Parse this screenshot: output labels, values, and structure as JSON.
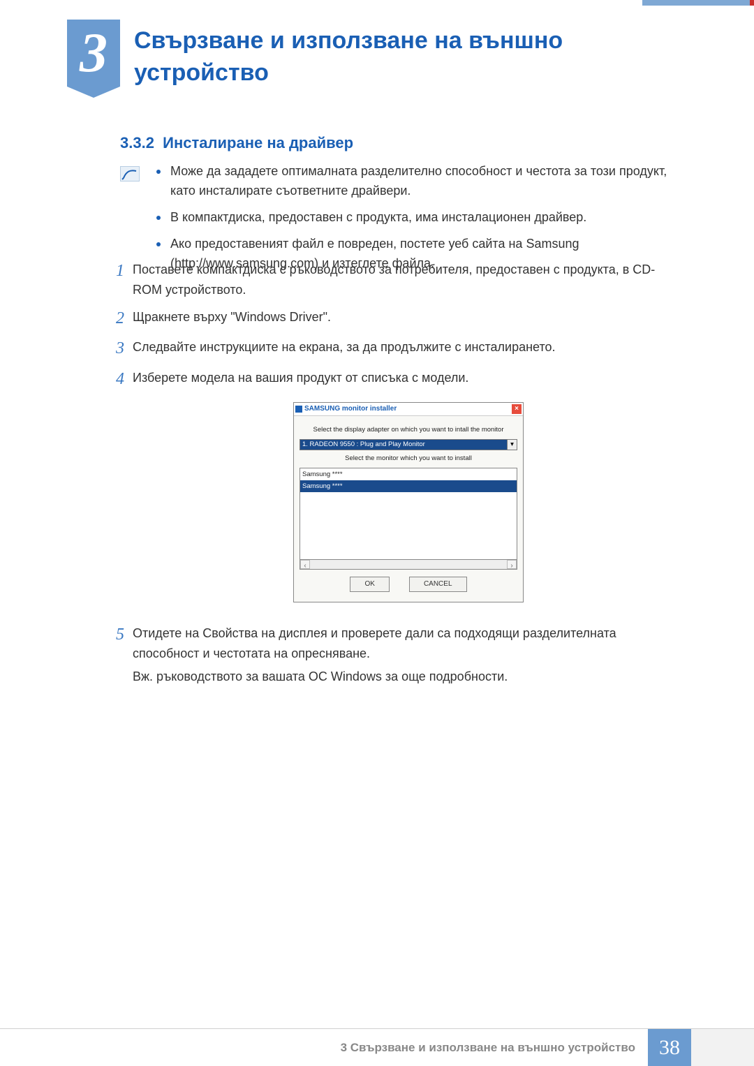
{
  "chapter": {
    "number": "3",
    "title": "Свързване и използване на външно устройство"
  },
  "section": {
    "number": "3.3.2",
    "title": "Инсталиране на драйвер"
  },
  "notes": [
    "Може да зададете оптималната разделително способност и честота за този продукт, като инсталирате съответните драйвери.",
    "В компактдиска, предоставен с продукта, има инсталационен драйвер.",
    "Ако предоставеният файл е повреден, постете уеб сайта на Samsung (http://www.samsung.com) и изтеглете файла."
  ],
  "steps": {
    "s1": "Поставете компактдиска с ръководството за потребителя, предоставен с продукта, в CD-ROM устройството.",
    "s2": "Щракнете върху \"Windows Driver\".",
    "s3": "Следвайте инструкциите на екрана, за да продължите с инсталирането.",
    "s4": "Изберете модела на вашия продукт от списъка с модели.",
    "s5": "Отидете на Свойства на дисплея и проверете дали са подходящи разделителната способност и честотата на опресняване.",
    "s5_sub": "Вж. ръководството за вашата ОС Windows за още подробности."
  },
  "dialog": {
    "title": "SAMSUNG monitor installer",
    "label_top": "Select the display adapter on which you want to intall the monitor",
    "combo": "1. RADEON 9550 : Plug and Play Monitor",
    "label_mid": "Select the monitor which you want to install",
    "items": {
      "a": "Samsung ****",
      "b": "Samsung ****"
    },
    "ok": "OK",
    "cancel": "CANCEL"
  },
  "footer": {
    "text": "3 Свързване и използване на външно устройство",
    "page": "38"
  }
}
